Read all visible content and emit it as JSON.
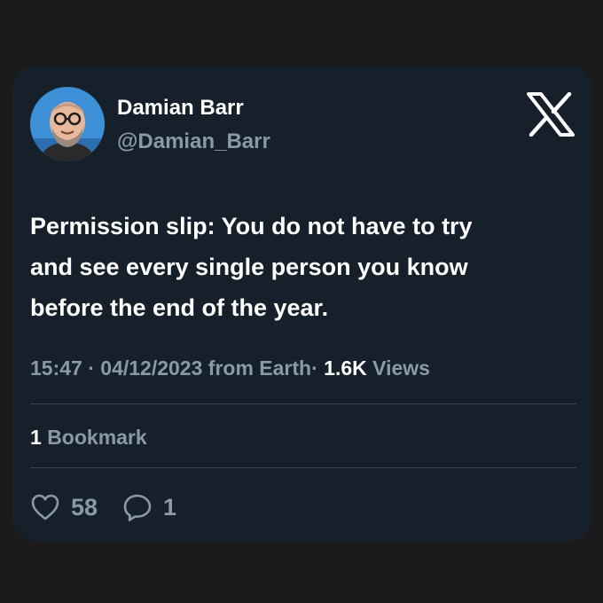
{
  "tweet": {
    "author": {
      "display_name": "Damian Barr",
      "handle": "@Damian_Barr",
      "avatar_icon": "avatar-photo"
    },
    "brand_icon": "x-logo-icon",
    "text_lines": [
      "Permission slip: You do not have to try",
      "and see every single person you know",
      "before the end of the year."
    ],
    "meta": {
      "time": "15:47",
      "date": "04/12/2023",
      "source": "from Earth",
      "separator": "·",
      "views_count": "1.6K",
      "views_label": "Views"
    },
    "bookmarks": {
      "count": "1",
      "label": "Bookmark"
    },
    "actions": {
      "likes": {
        "icon": "heart-icon",
        "count": "58"
      },
      "replies": {
        "icon": "reply-icon",
        "count": "1"
      }
    }
  },
  "colors": {
    "page_background": "#1a1a1a",
    "card_background": "#15202b",
    "primary_text": "#ffffff",
    "secondary_text": "#8b98a5",
    "divider": "#38444d"
  }
}
